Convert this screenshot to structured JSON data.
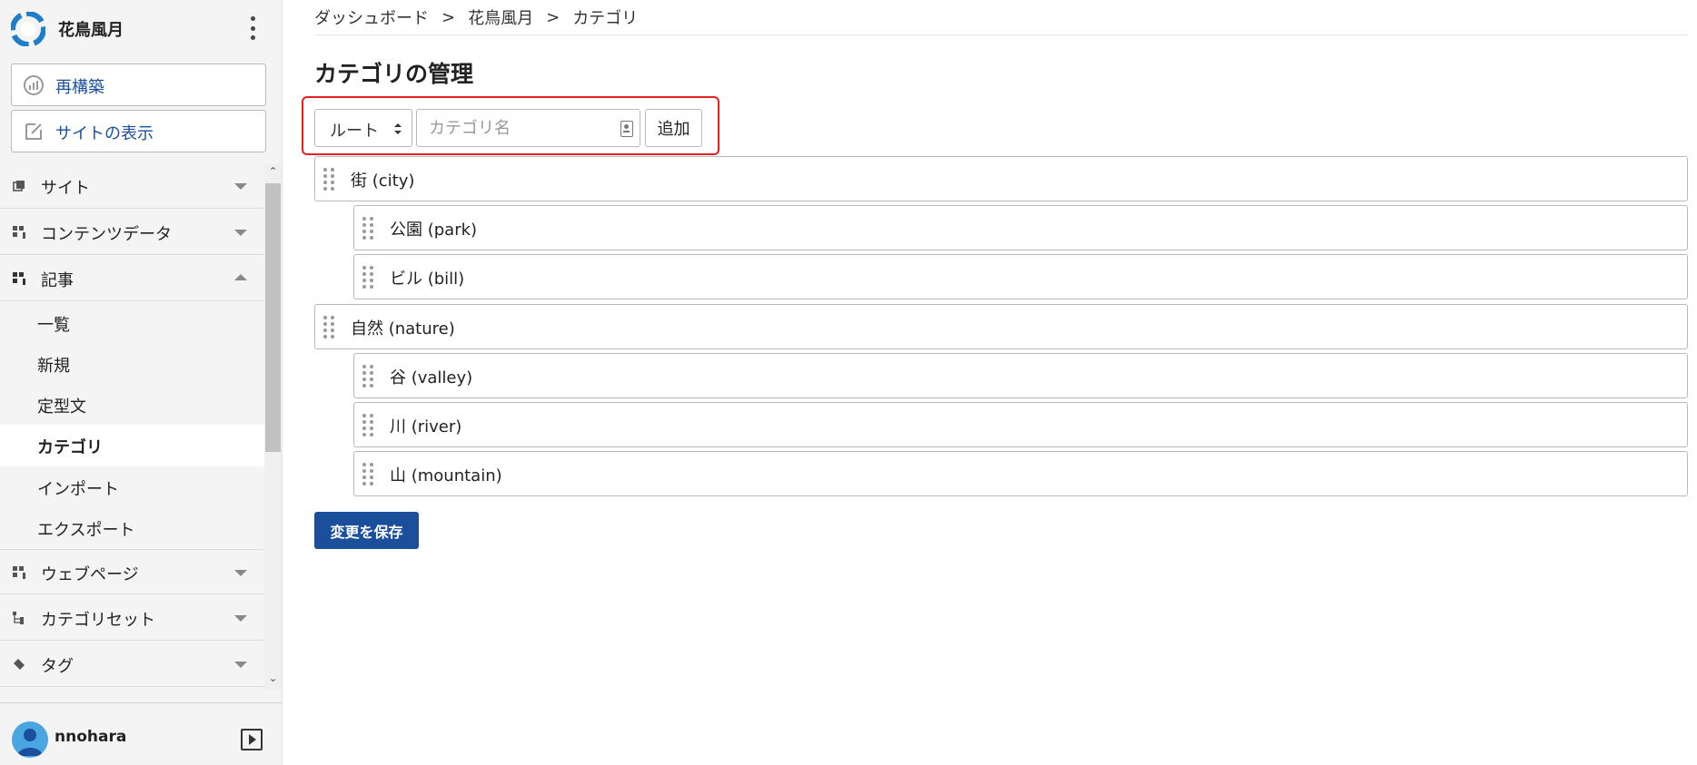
{
  "brand": {
    "name": "花鳥風月"
  },
  "sidebar": {
    "rebuild_label": "再構築",
    "view_site_label": "サイトの表示",
    "nav": [
      {
        "label": "サイト",
        "icon": "window-icon",
        "expanded": false
      },
      {
        "label": "コンテンツデータ",
        "icon": "grid-icon",
        "expanded": false
      },
      {
        "label": "記事",
        "icon": "grid-icon",
        "expanded": true
      },
      {
        "label": "ウェブページ",
        "icon": "grid-icon",
        "expanded": false
      },
      {
        "label": "カテゴリセット",
        "icon": "tree-icon",
        "expanded": false
      },
      {
        "label": "タグ",
        "icon": "tag-icon",
        "expanded": false
      }
    ],
    "article_sub": [
      {
        "label": "一覧"
      },
      {
        "label": "新規"
      },
      {
        "label": "定型文"
      },
      {
        "label": "カテゴリ",
        "active": true
      },
      {
        "label": "インポート"
      },
      {
        "label": "エクスポート"
      }
    ]
  },
  "user": {
    "name": "nnohara"
  },
  "breadcrumb": [
    "ダッシュボード",
    "花鳥風月",
    "カテゴリ"
  ],
  "breadcrumb_sep": ">",
  "page": {
    "title": "カテゴリの管理",
    "parent_select_value": "ルート",
    "category_input_placeholder": "カテゴリ名",
    "add_label": "追加",
    "save_label": "変更を保存"
  },
  "categories": [
    {
      "label": "街 (city)",
      "level": 0
    },
    {
      "label": "公園 (park)",
      "level": 1
    },
    {
      "label": "ビル (bill)",
      "level": 1
    },
    {
      "label": "自然 (nature)",
      "level": 0
    },
    {
      "label": "谷 (valley)",
      "level": 1
    },
    {
      "label": "川 (river)",
      "level": 1
    },
    {
      "label": "山 (mountain)",
      "level": 1
    }
  ],
  "colors": {
    "accent": "#1b4f9c",
    "highlight": "#e02020",
    "logo": "#1e7fc8"
  }
}
